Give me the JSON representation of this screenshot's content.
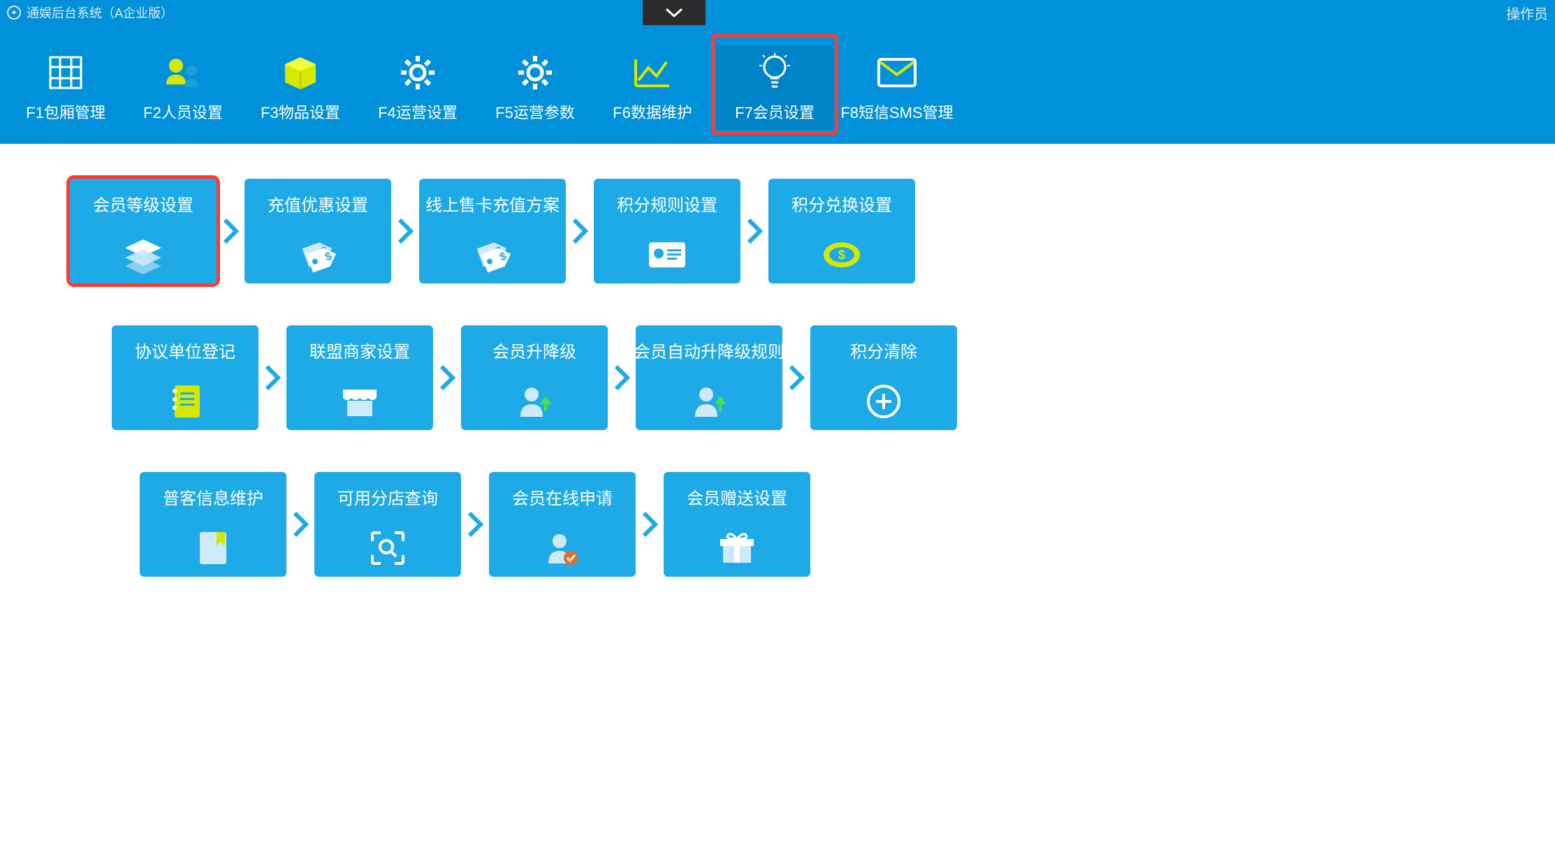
{
  "titlebar": {
    "app_name": "通娱后台系统（A企业版）",
    "operator_label": "操作员"
  },
  "nav": [
    {
      "label": "F1包厢管理",
      "icon": "grid"
    },
    {
      "label": "F2人员设置",
      "icon": "people"
    },
    {
      "label": "F3物品设置",
      "icon": "box"
    },
    {
      "label": "F4运营设置",
      "icon": "gear"
    },
    {
      "label": "F5运营参数",
      "icon": "gear2"
    },
    {
      "label": "F6数据维护",
      "icon": "chart"
    },
    {
      "label": "F7会员设置",
      "icon": "bulb",
      "active": true,
      "highlight": true
    },
    {
      "label": "F8短信SMS管理",
      "icon": "mail"
    }
  ],
  "rows": [
    [
      {
        "label": "会员等级设置",
        "icon": "layers",
        "highlight": true
      },
      {
        "label": "充值优惠设置",
        "icon": "tag"
      },
      {
        "label": "线上售卡充值方案",
        "icon": "tag"
      },
      {
        "label": "积分规则设置",
        "icon": "card"
      },
      {
        "label": "积分兑换设置",
        "icon": "coin"
      }
    ],
    [
      {
        "label": "协议单位登记",
        "icon": "notebook"
      },
      {
        "label": "联盟商家设置",
        "icon": "shop"
      },
      {
        "label": "会员升降级",
        "icon": "userUp"
      },
      {
        "label": "会员自动升降级规则",
        "icon": "userUp"
      },
      {
        "label": "积分清除",
        "icon": "plusCircle"
      }
    ],
    [
      {
        "label": "普客信息维护",
        "icon": "bookmark"
      },
      {
        "label": "可用分店查询",
        "icon": "scan"
      },
      {
        "label": "会员在线申请",
        "icon": "userCheck"
      },
      {
        "label": "会员赠送设置",
        "icon": "gift"
      }
    ]
  ]
}
